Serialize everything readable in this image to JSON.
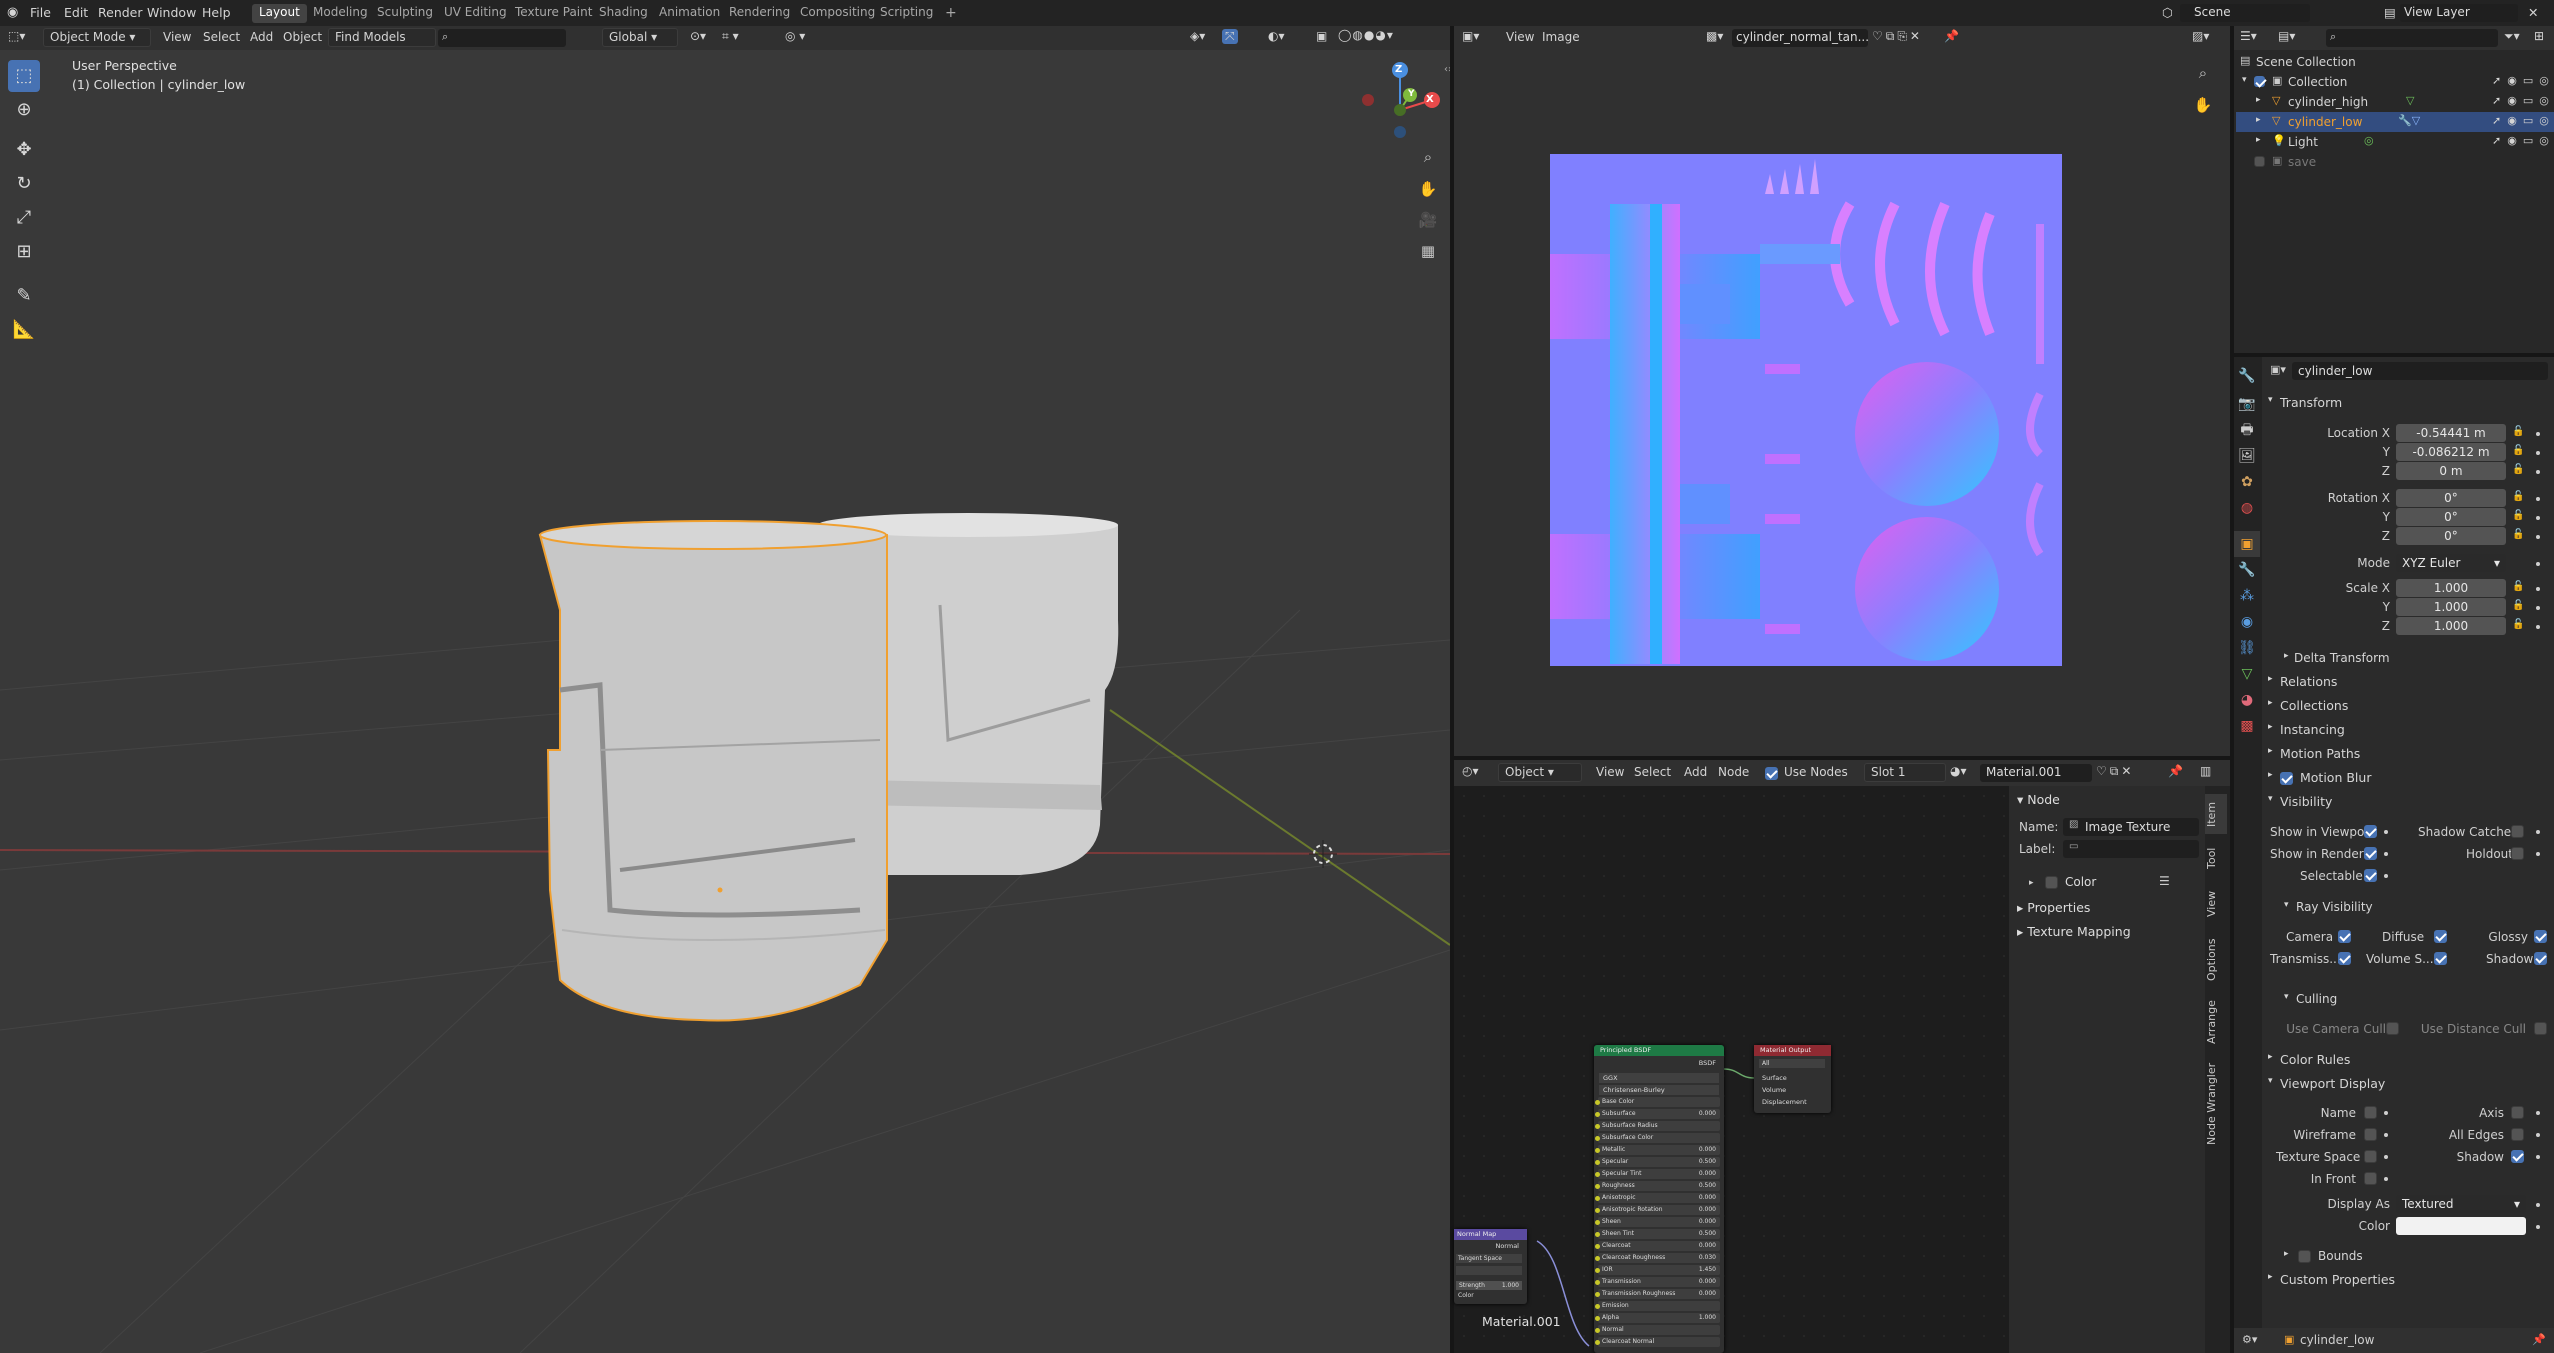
{
  "topbar": {
    "menu": [
      "File",
      "Edit",
      "Render",
      "Window",
      "Help"
    ],
    "workspaces": [
      "Layout",
      "Modeling",
      "Sculpting",
      "UV Editing",
      "Texture Paint",
      "Shading",
      "Animation",
      "Rendering",
      "Compositing",
      "Scripting"
    ],
    "active_workspace": "Layout",
    "scene": "Scene",
    "view_layer": "View Layer"
  },
  "viewport": {
    "mode": "Object Mode",
    "menu": [
      "View",
      "Select",
      "Add",
      "Object"
    ],
    "find_models": "Find Models",
    "orientation": "Global",
    "overlay_title": "User Perspective",
    "overlay_subtitle": "(1) Collection | cylinder_low",
    "gizmo_axes": [
      "X",
      "Y",
      "Z"
    ]
  },
  "image_editor": {
    "menu": [
      "View",
      "Image"
    ],
    "image_name": "cylinder_normal_tan..."
  },
  "node_editor": {
    "object": "Object",
    "menu": [
      "View",
      "Select",
      "Add",
      "Node"
    ],
    "use_nodes": "Use Nodes",
    "slot": "Slot 1",
    "material": "Material.001",
    "sidebar": {
      "header": "Node",
      "name_label": "Name:",
      "name_value": "Image Texture",
      "label_label": "Label:",
      "color": "Color",
      "properties": "Properties",
      "texture_mapping": "Texture Mapping"
    },
    "vtabs": [
      "Item",
      "Tool",
      "View",
      "Options",
      "Arrange",
      "Node Wrangler"
    ],
    "bsdf_node": {
      "title": "Principled BSDF",
      "output": "BSDF",
      "distribution": "GGX",
      "subsurface_method": "Christensen-Burley",
      "rows": [
        {
          "label": "Base Color",
          "value": ""
        },
        {
          "label": "Subsurface",
          "value": "0.000"
        },
        {
          "label": "Subsurface Radius",
          "value": ""
        },
        {
          "label": "Subsurface Color",
          "value": ""
        },
        {
          "label": "Metallic",
          "value": "0.000"
        },
        {
          "label": "Specular",
          "value": "0.500"
        },
        {
          "label": "Specular Tint",
          "value": "0.000"
        },
        {
          "label": "Roughness",
          "value": "0.500"
        },
        {
          "label": "Anisotropic",
          "value": "0.000"
        },
        {
          "label": "Anisotropic Rotation",
          "value": "0.000"
        },
        {
          "label": "Sheen",
          "value": "0.000"
        },
        {
          "label": "Sheen Tint",
          "value": "0.500"
        },
        {
          "label": "Clearcoat",
          "value": "0.000"
        },
        {
          "label": "Clearcoat Roughness",
          "value": "0.030"
        },
        {
          "label": "IOR",
          "value": "1.450"
        },
        {
          "label": "Transmission",
          "value": "0.000"
        },
        {
          "label": "Transmission Roughness",
          "value": "0.000"
        },
        {
          "label": "Emission",
          "value": ""
        },
        {
          "label": "Alpha",
          "value": "1.000"
        },
        {
          "label": "Normal",
          "value": ""
        },
        {
          "label": "Clearcoat Normal",
          "value": ""
        }
      ]
    },
    "output_node": {
      "title": "Material Output",
      "target": "All",
      "sockets": [
        "Surface",
        "Volume",
        "Displacement"
      ]
    },
    "normal_node": {
      "title": "Normal Map",
      "output": "Normal",
      "space": "Tangent Space",
      "strength_label": "Strength",
      "strength": "1.000",
      "color": "Color"
    },
    "material_label": "Material.001"
  },
  "outliner": {
    "root": "Scene Collection",
    "items": [
      {
        "label": "Collection",
        "indent": 1
      },
      {
        "label": "cylinder_high",
        "indent": 2
      },
      {
        "label": "cylinder_low",
        "indent": 2
      },
      {
        "label": "Light",
        "indent": 2
      },
      {
        "label": "save",
        "indent": 1
      }
    ]
  },
  "properties": {
    "object_name": "cylinder_low",
    "transform": "Transform",
    "location": {
      "label": "Location X",
      "x": "-0.54441 m",
      "y": "-0.086212 m",
      "z": "0 m"
    },
    "rotation": {
      "label": "Rotation X",
      "x": "0°",
      "y": "0°",
      "z": "0°"
    },
    "mode_label": "Mode",
    "mode_value": "XYZ Euler",
    "scale": {
      "label": "Scale X",
      "x": "1.000",
      "y": "1.000",
      "z": "1.000"
    },
    "axis_y": "Y",
    "axis_z": "Z",
    "delta": "Delta Transform",
    "sections": [
      "Relations",
      "Collections",
      "Instancing",
      "Motion Paths",
      "Motion Blur"
    ],
    "visibility": "Visibility",
    "show_in_viewports": "Show in Viewpo...",
    "shadow_catcher": "Shadow Catcher",
    "show_in_renders": "Show in Renders",
    "holdout": "Holdout",
    "selectable": "Selectable",
    "ray_visibility": "Ray Visibility",
    "camera": "Camera",
    "diffuse": "Diffuse",
    "glossy": "Glossy",
    "transmission": "Transmiss...",
    "volume": "Volume S...",
    "shadow": "Shadow",
    "culling": "Culling",
    "use_camera_cull": "Use Camera Cull",
    "use_distance_cull": "Use Distance Cull",
    "color_rules": "Color Rules",
    "viewport_display": "Viewport Display",
    "name": "Name",
    "axis": "Axis",
    "wireframe": "Wireframe",
    "all_edges": "All Edges",
    "texture_space": "Texture Space",
    "shadow2": "Shadow",
    "in_front": "In Front",
    "display_as_label": "Display As",
    "display_as": "Textured",
    "color": "Color",
    "bounds": "Bounds",
    "custom_properties": "Custom Properties",
    "footer_object": "cylinder_low"
  }
}
